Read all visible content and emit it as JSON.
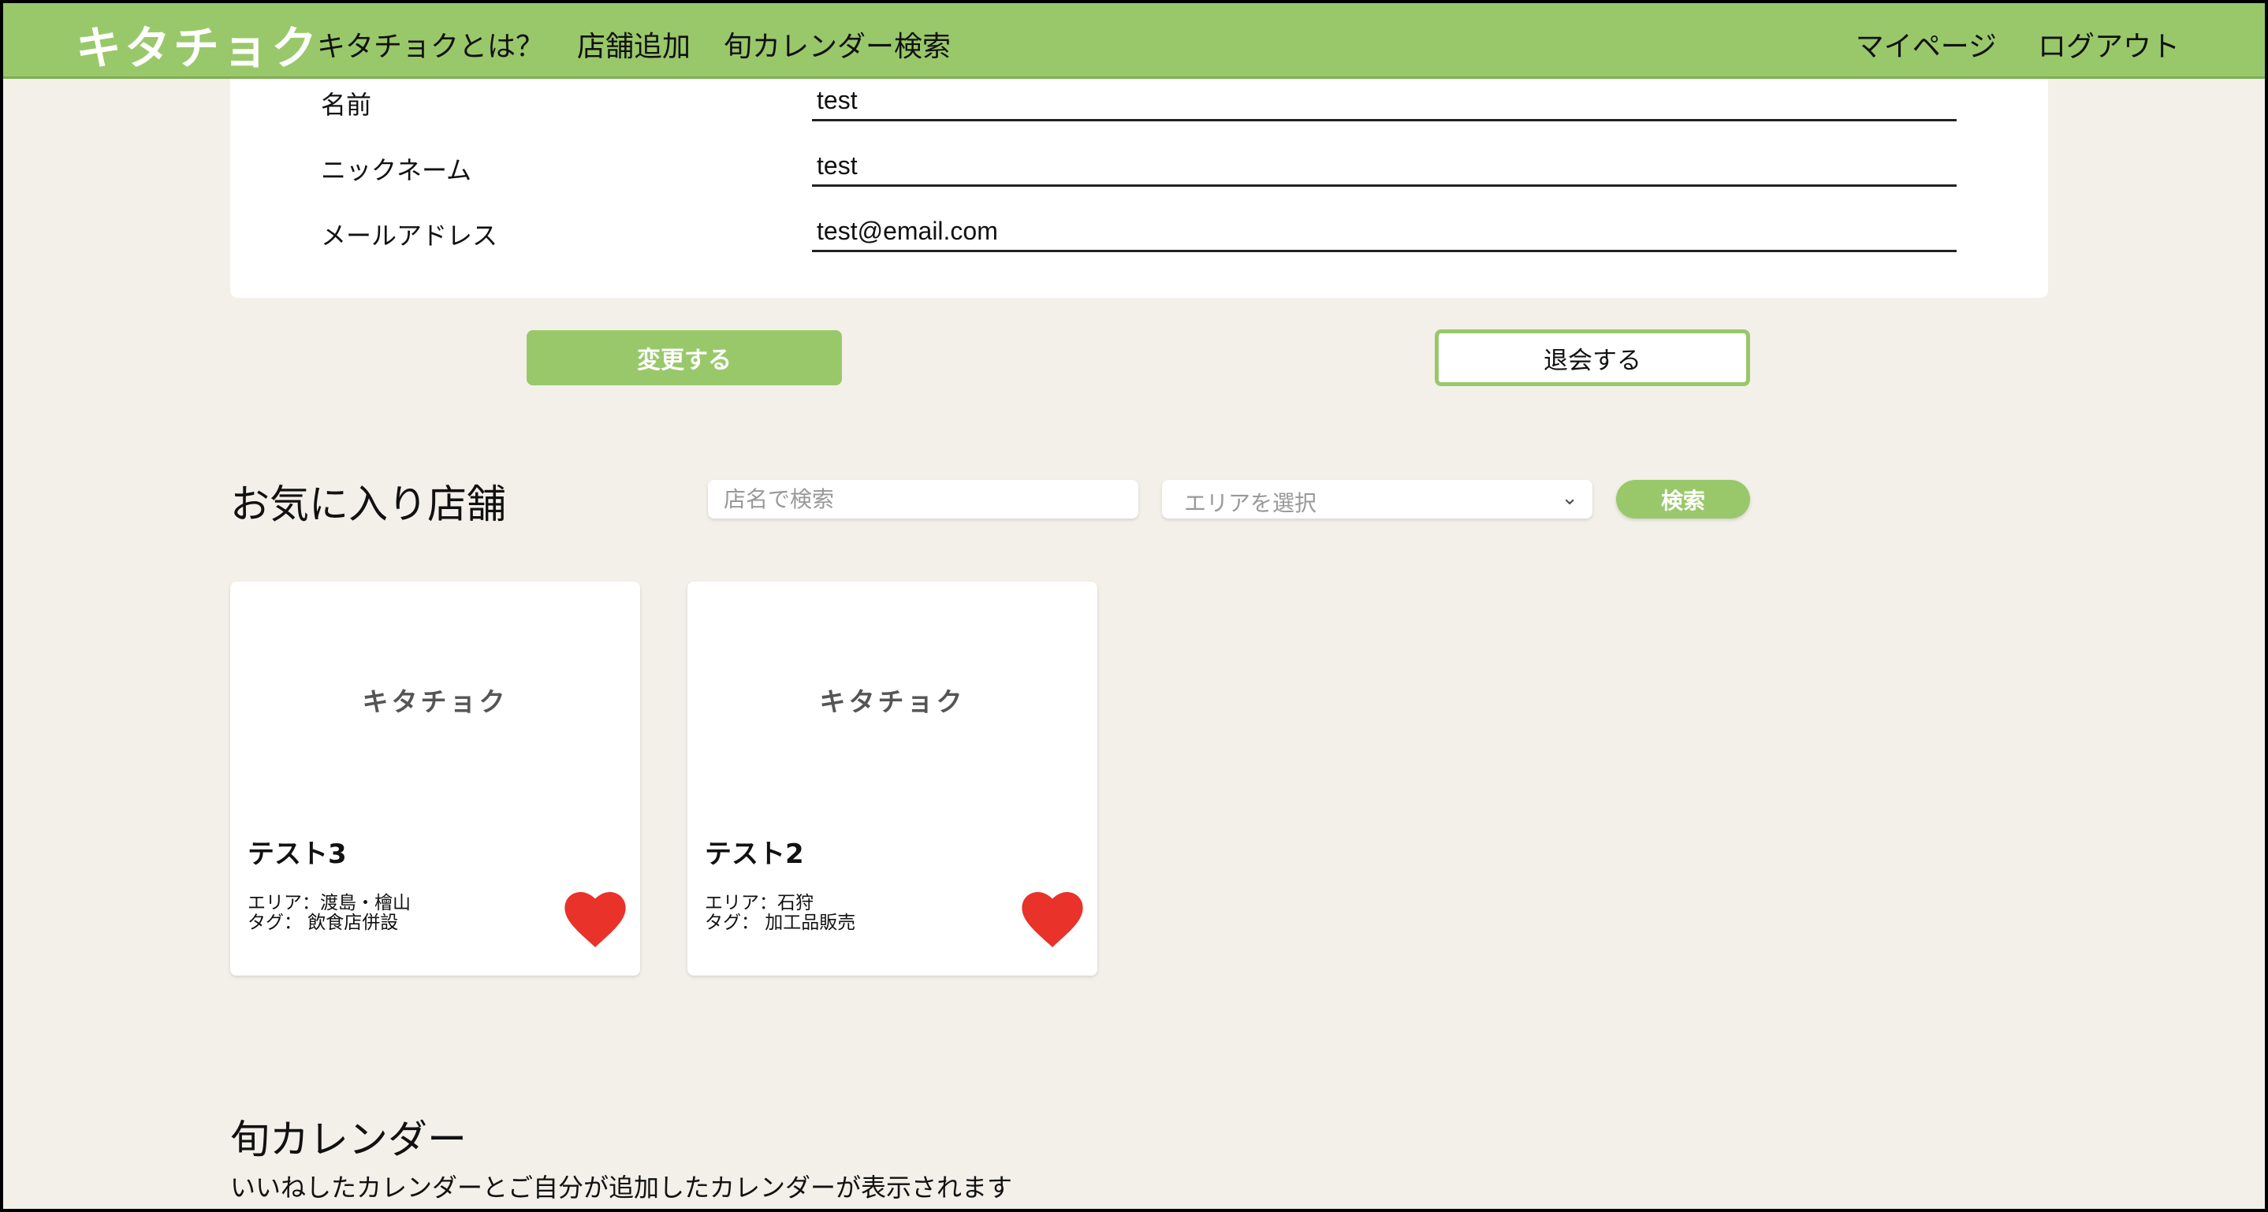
{
  "header": {
    "logo": "キタチョク",
    "nav_left": [
      "キタチョクとは？",
      "店舗追加",
      "旬カレンダー検索"
    ],
    "nav_right": [
      "マイページ",
      "ログアウト"
    ]
  },
  "profile": {
    "fields": [
      {
        "label": "名前",
        "value": "test"
      },
      {
        "label": "ニックネーム",
        "value": "test"
      },
      {
        "label": "メールアドレス",
        "value": "test@email.com"
      }
    ],
    "change_button": "変更する",
    "withdraw_button": "退会する"
  },
  "favorites": {
    "title": "お気に入り店舗",
    "search_placeholder": "店名で検索",
    "area_placeholder": "エリアを選択",
    "search_button": "検索",
    "cards": [
      {
        "image_text": "キタチョク",
        "name": "テスト3",
        "area": "エリア：渡島・檜山",
        "tag": "タグ： 飲食店併設"
      },
      {
        "image_text": "キタチョク",
        "name": "テスト2",
        "area": "エリア：石狩",
        "tag": "タグ： 加工品販売"
      }
    ]
  },
  "calendar": {
    "title": "旬カレンダー",
    "description": "いいねしたカレンダーとご自分が追加したカレンダーが表示されます"
  },
  "colors": {
    "accent": "#99c86a",
    "background": "#f3f0e9",
    "heart": "#e8322a"
  }
}
